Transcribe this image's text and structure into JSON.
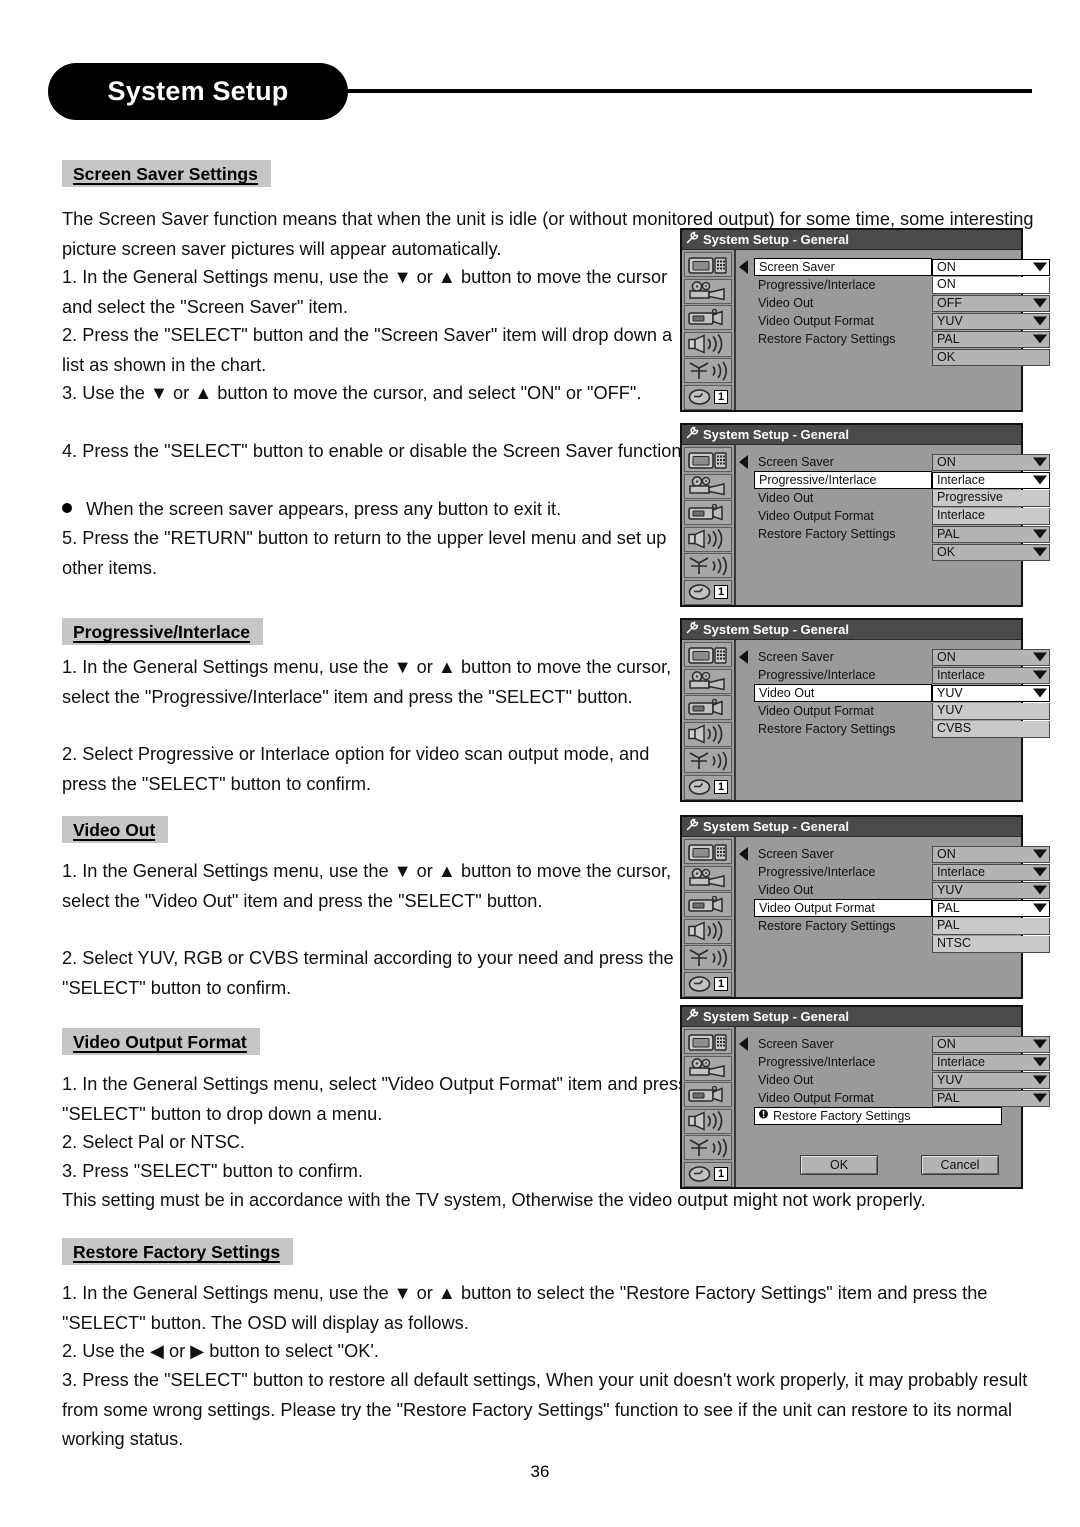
{
  "page": {
    "title": "System Setup",
    "number": "36"
  },
  "sections": [
    {
      "id": "screen-saver",
      "heading": "Screen Saver Settings",
      "paragraphs": [
        "The Screen Saver function means that when the unit is idle (or without monitored output) for some time, some interesting picture screen saver pictures will appear automatically.",
        "1. In the General Settings menu, use the ▼ or ▲ button to move the cursor and select the \"Screen Saver\" item.",
        "2. Press the \"SELECT\" button and the \"Screen Saver\" item will drop down a list as shown in the chart.",
        "3. Use the ▼ or ▲ button to move the cursor, and select \"ON\" or \"OFF\".",
        "4. Press the \"SELECT\" button to enable or disable the Screen Saver function."
      ],
      "bullet": "When the screen saver appears, press any button to exit it.",
      "paragraphs_after": [
        "5. Press the \"RETURN\" button to return to the upper level menu and set up other items."
      ]
    },
    {
      "id": "progressive-interlace",
      "heading": "Progressive/Interlace",
      "paragraphs": [
        "1. In the General Settings menu, use the ▼ or ▲ button to move the cursor, select the \"Progressive/Interlace\" item and press the \"SELECT\" button.",
        "2. Select Progressive or Interlace option for video scan output mode, and press the \"SELECT\" button to confirm."
      ]
    },
    {
      "id": "video-out",
      "heading": "Video Out",
      "paragraphs": [
        "1. In the General Settings menu, use the ▼ or ▲ button to move the cursor, select the \"Video Out\" item and press the \"SELECT\" button.",
        "2. Select YUV, RGB or CVBS terminal according to your need and press the \"SELECT\" button to confirm."
      ]
    },
    {
      "id": "video-output-format",
      "heading": "Video Output Format",
      "paragraphs": [
        "1. In the General Settings menu, select \"Video Output Format\" item and press \"SELECT\" button to drop down a menu.",
        "2. Select Pal or NTSC.",
        "3. Press \"SELECT\" button to confirm."
      ],
      "note": "This setting must be in accordance with the TV system, Otherwise the video output might not work properly."
    },
    {
      "id": "restore-factory-settings",
      "heading": "Restore Factory Settings",
      "paragraphs": [
        "1. In the General Settings menu, use the ▼ or ▲ button to select the \"Restore Factory Settings\" item and press the \"SELECT\" button. The OSD will display as follows.",
        "2. Use the ◀ or ▶ button to select \"OK'.",
        "3. Press the \"SELECT\" button to restore all default settings, When your unit doesn't work properly, it may probably result from some wrong settings. Please try the \"Restore Factory Settings\" function to see if the unit can restore to its normal working status."
      ]
    }
  ],
  "osd": {
    "title": "System Setup - General",
    "rail_icons": [
      "tv-keypad-icon",
      "film-projector-icon",
      "camcorder-icon",
      "speaker-icon",
      "antenna-icon",
      "clock-dial-icon"
    ],
    "rail_badge": "1",
    "panels": [
      {
        "id": "panel-screen-saver",
        "rows": [
          {
            "label": "Screen Saver",
            "label_selected": true,
            "value": "ON",
            "value_selected": true,
            "arrow": true
          },
          {
            "label": "Progressive/Interlace",
            "label_selected": false,
            "value": "ON",
            "option": "white",
            "arrow": false
          },
          {
            "label": "Video Out",
            "label_selected": false,
            "value": "OFF",
            "arrow": true
          },
          {
            "label": "Video Output Format",
            "label_selected": false,
            "value": "YUV",
            "arrow": true
          },
          {
            "label": "Restore Factory Settings",
            "label_selected": false,
            "value": "PAL",
            "arrow": true
          },
          {
            "label": "",
            "label_selected": false,
            "value": "OK",
            "arrow": false
          }
        ]
      },
      {
        "id": "panel-progressive-interlace",
        "rows": [
          {
            "label": "Screen Saver",
            "label_selected": false,
            "value": "ON",
            "arrow": true
          },
          {
            "label": "Progressive/Interlace",
            "label_selected": true,
            "value": "Interlace",
            "value_selected": true,
            "arrow": true
          },
          {
            "label": "Video Out",
            "label_selected": false,
            "value": "Progressive",
            "option": "grey",
            "arrow": false
          },
          {
            "label": "Video Output Format",
            "label_selected": false,
            "value": "Interlace",
            "option": "grey",
            "arrow": false
          },
          {
            "label": "Restore Factory Settings",
            "label_selected": false,
            "value": "PAL",
            "arrow": true
          },
          {
            "label": "",
            "label_selected": false,
            "value": "OK",
            "arrow": true
          }
        ]
      },
      {
        "id": "panel-video-out",
        "rows": [
          {
            "label": "Screen Saver",
            "label_selected": false,
            "value": "ON",
            "arrow": true
          },
          {
            "label": "Progressive/Interlace",
            "label_selected": false,
            "value": "Interlace",
            "arrow": true
          },
          {
            "label": "Video Out",
            "label_selected": true,
            "value": "YUV",
            "value_selected": true,
            "arrow": true
          },
          {
            "label": "Video Output Format",
            "label_selected": false,
            "value": "YUV",
            "option": "grey",
            "arrow": false
          },
          {
            "label": "Restore Factory Settings",
            "label_selected": false,
            "value": "CVBS",
            "option": "grey",
            "arrow": false
          }
        ]
      },
      {
        "id": "panel-video-output-format",
        "rows": [
          {
            "label": "Screen Saver",
            "label_selected": false,
            "value": "ON",
            "arrow": true
          },
          {
            "label": "Progressive/Interlace",
            "label_selected": false,
            "value": "Interlace",
            "arrow": true
          },
          {
            "label": "Video Out",
            "label_selected": false,
            "value": "YUV",
            "arrow": true
          },
          {
            "label": "Video Output Format",
            "label_selected": true,
            "value": "PAL",
            "value_selected": true,
            "arrow": true
          },
          {
            "label": "Restore Factory Settings",
            "label_selected": false,
            "value": "PAL",
            "option": "grey",
            "arrow": false
          },
          {
            "label": "",
            "label_selected": false,
            "value": "NTSC",
            "option": "grey",
            "arrow": false
          }
        ]
      },
      {
        "id": "panel-restore-factory-settings",
        "rows": [
          {
            "label": "Screen Saver",
            "label_selected": false,
            "value": "ON",
            "arrow": true
          },
          {
            "label": "Progressive/Interlace",
            "label_selected": false,
            "value": "Interlace",
            "arrow": true
          },
          {
            "label": "Video Out",
            "label_selected": false,
            "value": "YUV",
            "arrow": true
          },
          {
            "label": "Video Output Format",
            "label_selected": false,
            "value": "PAL",
            "arrow": true
          },
          {
            "label": "Restore Factory Settings",
            "label_selected": true,
            "warn": true,
            "value": null,
            "arrow": false
          }
        ],
        "buttons": {
          "ok": "OK",
          "cancel": "Cancel"
        }
      }
    ]
  }
}
